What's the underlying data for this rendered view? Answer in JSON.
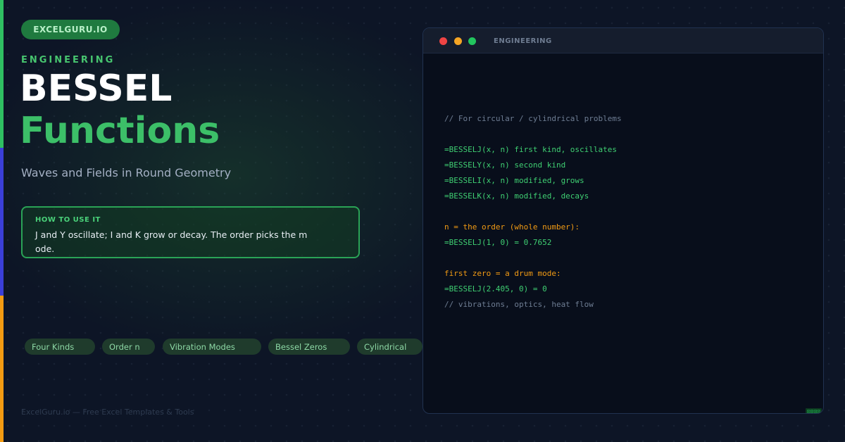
{
  "brand": {
    "pill_label": "EXCELGURU.IO"
  },
  "hero": {
    "eyebrow": "ENGINEERING",
    "title_line1": "BESSEL",
    "title_line2": "Functions",
    "subtitle": "Waves and Fields in Round Geometry"
  },
  "tip": {
    "heading": "HOW TO USE IT",
    "body": "J and Y oscillate; I and K grow or decay. The order picks the mode."
  },
  "tags": [
    "Four Kinds",
    "Order n",
    "Vibration Modes",
    "Bessel Zeros",
    "Cylindrical"
  ],
  "footer": {
    "text": "ExcelGuru.io — Free Excel Templates & Tools"
  },
  "window": {
    "title": "ENGINEERING",
    "code_lines": [
      {
        "kind": "comment",
        "text": "// For circular / cylindrical problems"
      },
      {
        "kind": "blank",
        "text": ""
      },
      {
        "kind": "formula",
        "text": "=BESSELJ(x, n) first kind, oscillates"
      },
      {
        "kind": "formula",
        "text": "=BESSELY(x, n) second kind"
      },
      {
        "kind": "formula",
        "text": "=BESSELI(x, n) modified, grows"
      },
      {
        "kind": "formula",
        "text": "=BESSELK(x, n) modified, decays"
      },
      {
        "kind": "blank",
        "text": ""
      },
      {
        "kind": "note",
        "text": "n = the order (whole number):"
      },
      {
        "kind": "formula",
        "text": "=BESSELJ(1, 0) = 0.7652"
      },
      {
        "kind": "blank",
        "text": ""
      },
      {
        "kind": "note",
        "text": "first zero = a drum mode:"
      },
      {
        "kind": "formula",
        "text": "=BESSELJ(2.405, 0) = 0"
      },
      {
        "kind": "comment",
        "text": "// vibrations, optics, heat flow"
      }
    ],
    "corner_mark": "⊠⊠⊠⊠"
  },
  "colors": {
    "background": "#0d1526",
    "accent_green": "#3cbf68",
    "accent_blue": "#3b3fd8",
    "accent_orange": "#f39b12",
    "code_formula": "#3fcf72",
    "code_note": "#f29b14",
    "code_comment": "#6e7d93"
  }
}
